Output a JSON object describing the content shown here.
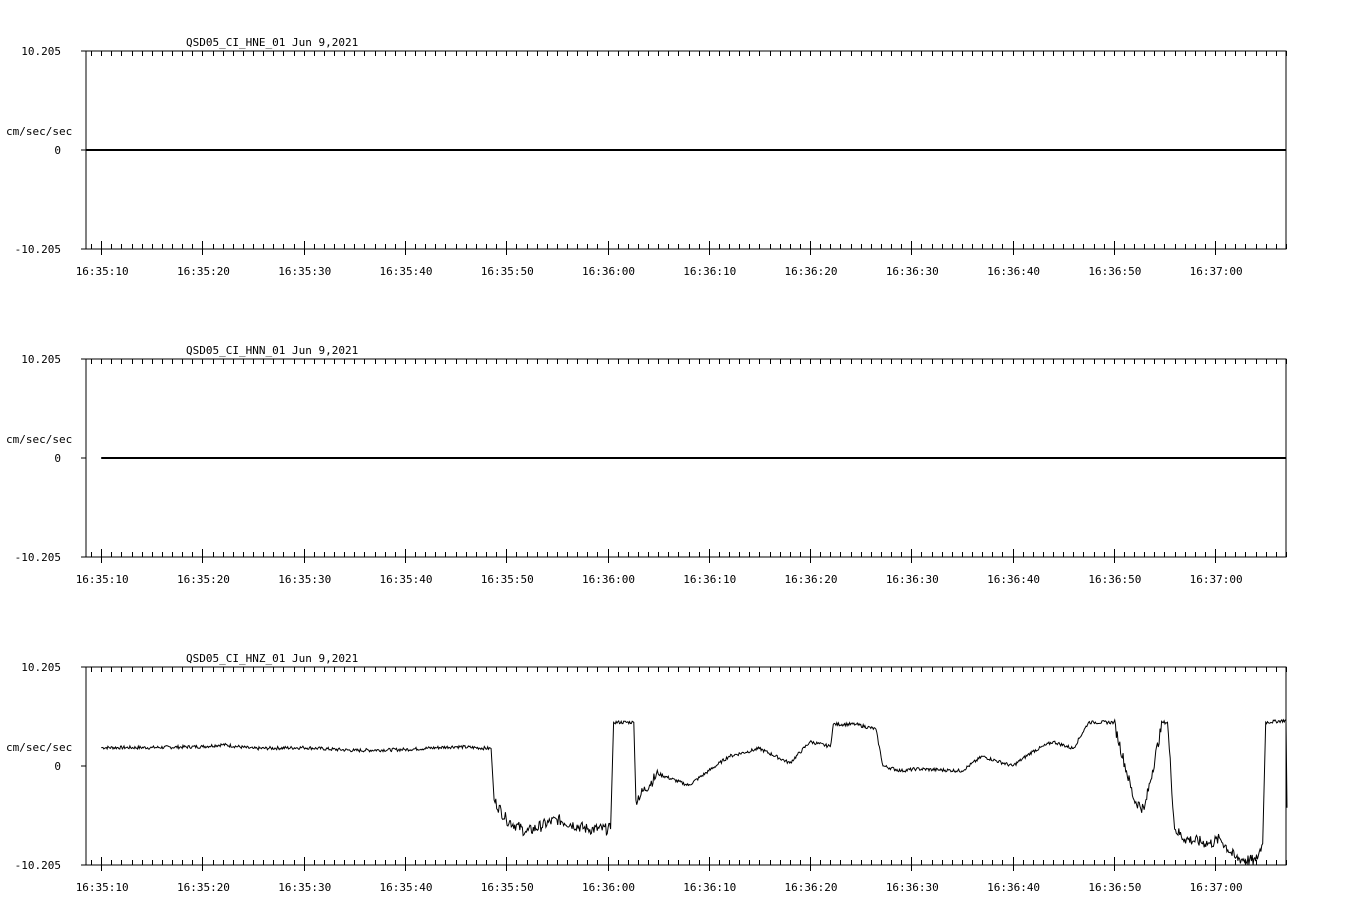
{
  "chart_data": [
    {
      "type": "line",
      "title": "QSD05_CI_HNE_01  Jun 9,2021",
      "ylabel": "cm/sec/sec",
      "ylim": [
        -10.205,
        10.205
      ],
      "y_tick_labels": [
        "10.205",
        "0",
        "-10.205"
      ],
      "x_tick_labels": [
        "16:35:10",
        "16:35:20",
        "16:35:30",
        "16:35:40",
        "16:35:50",
        "16:36:00",
        "16:36:10",
        "16:36:20",
        "16:36:30",
        "16:36:40",
        "16:36:50",
        "16:37:00"
      ],
      "x_start": "16:35:08.5",
      "x_end": "16:37:07",
      "grid": false,
      "series": [
        {
          "x_seconds": [
            8.5,
            127
          ],
          "values": [
            0,
            0
          ]
        }
      ]
    },
    {
      "type": "line",
      "title": "QSD05_CI_HNN_01  Jun 9,2021",
      "ylabel": "cm/sec/sec",
      "ylim": [
        -10.205,
        10.205
      ],
      "y_tick_labels": [
        "10.205",
        "0",
        "-10.205"
      ],
      "x_tick_labels": [
        "16:35:10",
        "16:35:20",
        "16:35:30",
        "16:35:40",
        "16:35:50",
        "16:36:00",
        "16:36:10",
        "16:36:20",
        "16:36:30",
        "16:36:40",
        "16:36:50",
        "16:37:00"
      ],
      "x_start": "16:35:08.5",
      "x_end": "16:37:07",
      "grid": false,
      "series": [
        {
          "x_seconds": [
            10,
            127
          ],
          "values": [
            0,
            0
          ]
        }
      ]
    },
    {
      "type": "line",
      "title": "QSD05_CI_HNZ_01  Jun 9,2021",
      "ylabel": "cm/sec/sec",
      "ylim": [
        -10.205,
        10.205
      ],
      "y_tick_labels": [
        "10.205",
        "0",
        "-10.205"
      ],
      "x_tick_labels": [
        "16:35:10",
        "16:35:20",
        "16:35:30",
        "16:35:40",
        "16:35:50",
        "16:36:00",
        "16:36:10",
        "16:36:20",
        "16:36:30",
        "16:36:40",
        "16:36:50",
        "16:37:00"
      ],
      "x_start": "16:35:08.5",
      "x_end": "16:37:07",
      "grid": false,
      "series": [
        {
          "x_seconds": [
            10,
            15,
            20,
            22,
            25,
            30,
            35,
            40,
            45,
            48.5,
            48.8,
            50,
            52,
            55,
            58,
            60.3,
            60.6,
            62.6,
            62.8,
            65,
            68,
            70,
            72,
            75,
            78,
            80,
            82,
            82.3,
            84.5,
            86.5,
            87.2,
            89,
            90.5,
            95,
            97,
            100,
            102,
            104,
            106,
            107.5,
            108,
            110,
            112,
            113,
            114.8,
            115.3,
            116,
            117,
            119.5,
            120.5,
            122,
            124,
            124.7,
            125,
            127,
            127.1
          ],
          "values": [
            1.9,
            1.9,
            2.0,
            2.2,
            1.8,
            1.9,
            1.6,
            1.7,
            2.0,
            1.8,
            -3.5,
            -5.5,
            -6.8,
            -5.5,
            -6.5,
            -6.5,
            4.5,
            4.5,
            -3.5,
            -0.8,
            -2.0,
            -0.5,
            1.0,
            1.8,
            0.3,
            2.5,
            2.0,
            4.3,
            4.3,
            3.8,
            0.0,
            -0.5,
            -0.3,
            -0.5,
            1.0,
            0.0,
            1.5,
            2.5,
            1.8,
            4.5,
            4.5,
            4.5,
            -3.5,
            -4.5,
            4.5,
            4.5,
            -6.5,
            -7.5,
            -8.0,
            -7.5,
            -9.5,
            -9.8,
            -8.0,
            4.5,
            4.7,
            -4.3
          ]
        }
      ]
    }
  ]
}
